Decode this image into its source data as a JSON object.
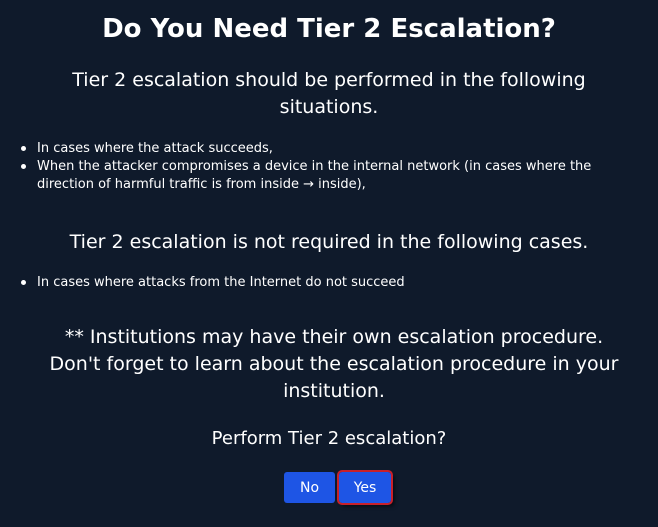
{
  "dialog": {
    "title": "Do You Need Tier 2 Escalation?",
    "required_heading": "Tier 2 escalation should be performed in the following situations.",
    "required_items": [
      "In cases where the attack succeeds,",
      "When the attacker compromises a device in the internal network (in cases where the direction of harmful traffic is from inside → inside),"
    ],
    "not_required_heading": "Tier 2 escalation is not required in the following cases.",
    "not_required_items": [
      "In cases where attacks from the Internet do not succeed"
    ],
    "note": "** Institutions may have their own escalation procedure. Don't forget to learn about the escalation procedure in your institution.",
    "question": "Perform Tier 2 escalation?",
    "no_label": "No",
    "yes_label": "Yes"
  },
  "colors": {
    "background": "#0f1a2b",
    "button": "#1e55e5",
    "focus_outline": "#c8202a",
    "text": "#ffffff"
  }
}
